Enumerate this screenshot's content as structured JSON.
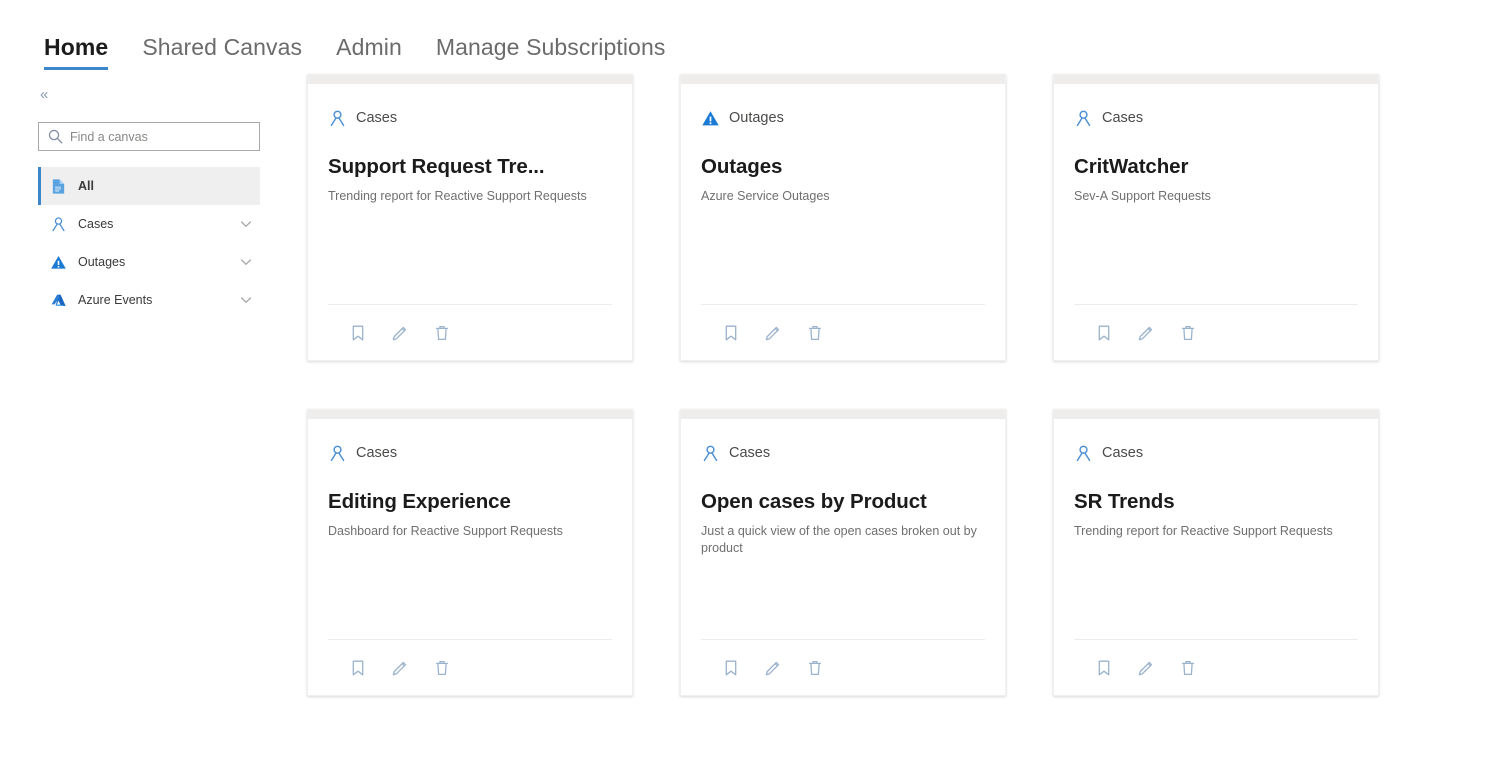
{
  "nav": {
    "tabs": [
      {
        "label": "Home",
        "active": true
      },
      {
        "label": "Shared Canvas",
        "active": false
      },
      {
        "label": "Admin",
        "active": false
      },
      {
        "label": "Manage Subscriptions",
        "active": false
      }
    ]
  },
  "sidebar": {
    "collapse_glyph": "«",
    "search": {
      "placeholder": "Find a canvas",
      "value": "",
      "icon": "search-icon"
    },
    "items": [
      {
        "label": "All",
        "icon": "page-document-icon",
        "selected": true,
        "expandable": false
      },
      {
        "label": "Cases",
        "icon": "person-contact-icon",
        "selected": false,
        "expandable": true
      },
      {
        "label": "Outages",
        "icon": "warning-triangle-icon",
        "selected": false,
        "expandable": true
      },
      {
        "label": "Azure Events",
        "icon": "azure-logo-icon",
        "selected": false,
        "expandable": true
      }
    ]
  },
  "cards": [
    {
      "category": "Cases",
      "category_icon": "person-contact-icon",
      "title": "Support Request Tre...",
      "description": "Trending report for Reactive Support Requests",
      "actions": [
        {
          "name": "bookmark-icon",
          "label": "Bookmark"
        },
        {
          "name": "edit-pencil-icon",
          "label": "Edit"
        },
        {
          "name": "delete-trash-icon",
          "label": "Delete"
        }
      ]
    },
    {
      "category": "Outages",
      "category_icon": "warning-triangle-icon",
      "title": "Outages",
      "description": "Azure Service Outages",
      "actions": [
        {
          "name": "bookmark-icon",
          "label": "Bookmark"
        },
        {
          "name": "edit-pencil-icon",
          "label": "Edit"
        },
        {
          "name": "delete-trash-icon",
          "label": "Delete"
        }
      ]
    },
    {
      "category": "Cases",
      "category_icon": "person-contact-icon",
      "title": "CritWatcher",
      "description": "Sev-A Support Requests",
      "actions": [
        {
          "name": "bookmark-icon",
          "label": "Bookmark"
        },
        {
          "name": "edit-pencil-icon",
          "label": "Edit"
        },
        {
          "name": "delete-trash-icon",
          "label": "Delete"
        }
      ]
    },
    {
      "category": "Cases",
      "category_icon": "person-contact-icon",
      "title": "Editing Experience",
      "description": "Dashboard for Reactive Support Requests",
      "actions": [
        {
          "name": "bookmark-icon",
          "label": "Bookmark"
        },
        {
          "name": "edit-pencil-icon",
          "label": "Edit"
        },
        {
          "name": "delete-trash-icon",
          "label": "Delete"
        }
      ]
    },
    {
      "category": "Cases",
      "category_icon": "person-contact-icon",
      "title": "Open cases by Product",
      "description": "Just a quick view of the open cases broken out by product",
      "actions": [
        {
          "name": "bookmark-icon",
          "label": "Bookmark"
        },
        {
          "name": "edit-pencil-icon",
          "label": "Edit"
        },
        {
          "name": "delete-trash-icon",
          "label": "Delete"
        }
      ]
    },
    {
      "category": "Cases",
      "category_icon": "person-contact-icon",
      "title": "SR Trends",
      "description": "Trending report for Reactive Support Requests",
      "actions": [
        {
          "name": "bookmark-icon",
          "label": "Bookmark"
        },
        {
          "name": "edit-pencil-icon",
          "label": "Edit"
        },
        {
          "name": "delete-trash-icon",
          "label": "Delete"
        }
      ]
    }
  ],
  "colors": {
    "accent_blue": "#3b87c9",
    "icon_blue": "#4a8fd4",
    "azure_blue": "#1c7ad4",
    "selected_bg": "#efefef",
    "card_topbar": "#eeedeb",
    "title_text": "#1b1b1b",
    "muted_text": "#6f6f6f",
    "action_icon": "#9bb3cc"
  }
}
